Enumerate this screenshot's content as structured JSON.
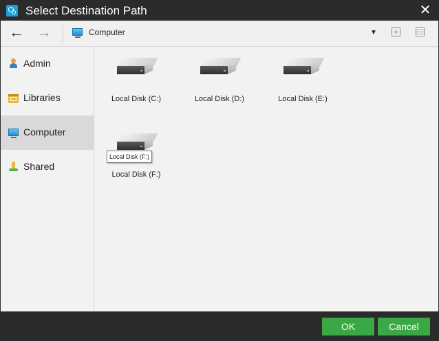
{
  "window": {
    "title": "Select Destination Path"
  },
  "toolbar": {
    "path": "Computer"
  },
  "sidebar": {
    "items": [
      {
        "label": "Admin",
        "icon": "admin-user-icon"
      },
      {
        "label": "Libraries",
        "icon": "libraries-folder-icon"
      },
      {
        "label": "Computer",
        "icon": "computer-monitor-icon",
        "selected": true
      },
      {
        "label": "Shared",
        "icon": "shared-icon"
      }
    ]
  },
  "content": {
    "disks": [
      {
        "label": "Local Disk (C:)",
        "icon": "hard-disk-icon"
      },
      {
        "label": "Local Disk (D:)",
        "icon": "hard-disk-icon"
      },
      {
        "label": "Local Disk (E:)",
        "icon": "hard-disk-icon"
      },
      {
        "label": "Local Disk (F:)",
        "icon": "hard-disk-icon"
      }
    ],
    "tooltip": "Local Disk (F:)"
  },
  "footer": {
    "ok_label": "OK",
    "cancel_label": "Cancel"
  },
  "colors": {
    "titlebar": "#2b2b2b",
    "accent_button": "#3aa845",
    "selected_item": "#d9d9d9",
    "background": "#f2f2f2"
  }
}
